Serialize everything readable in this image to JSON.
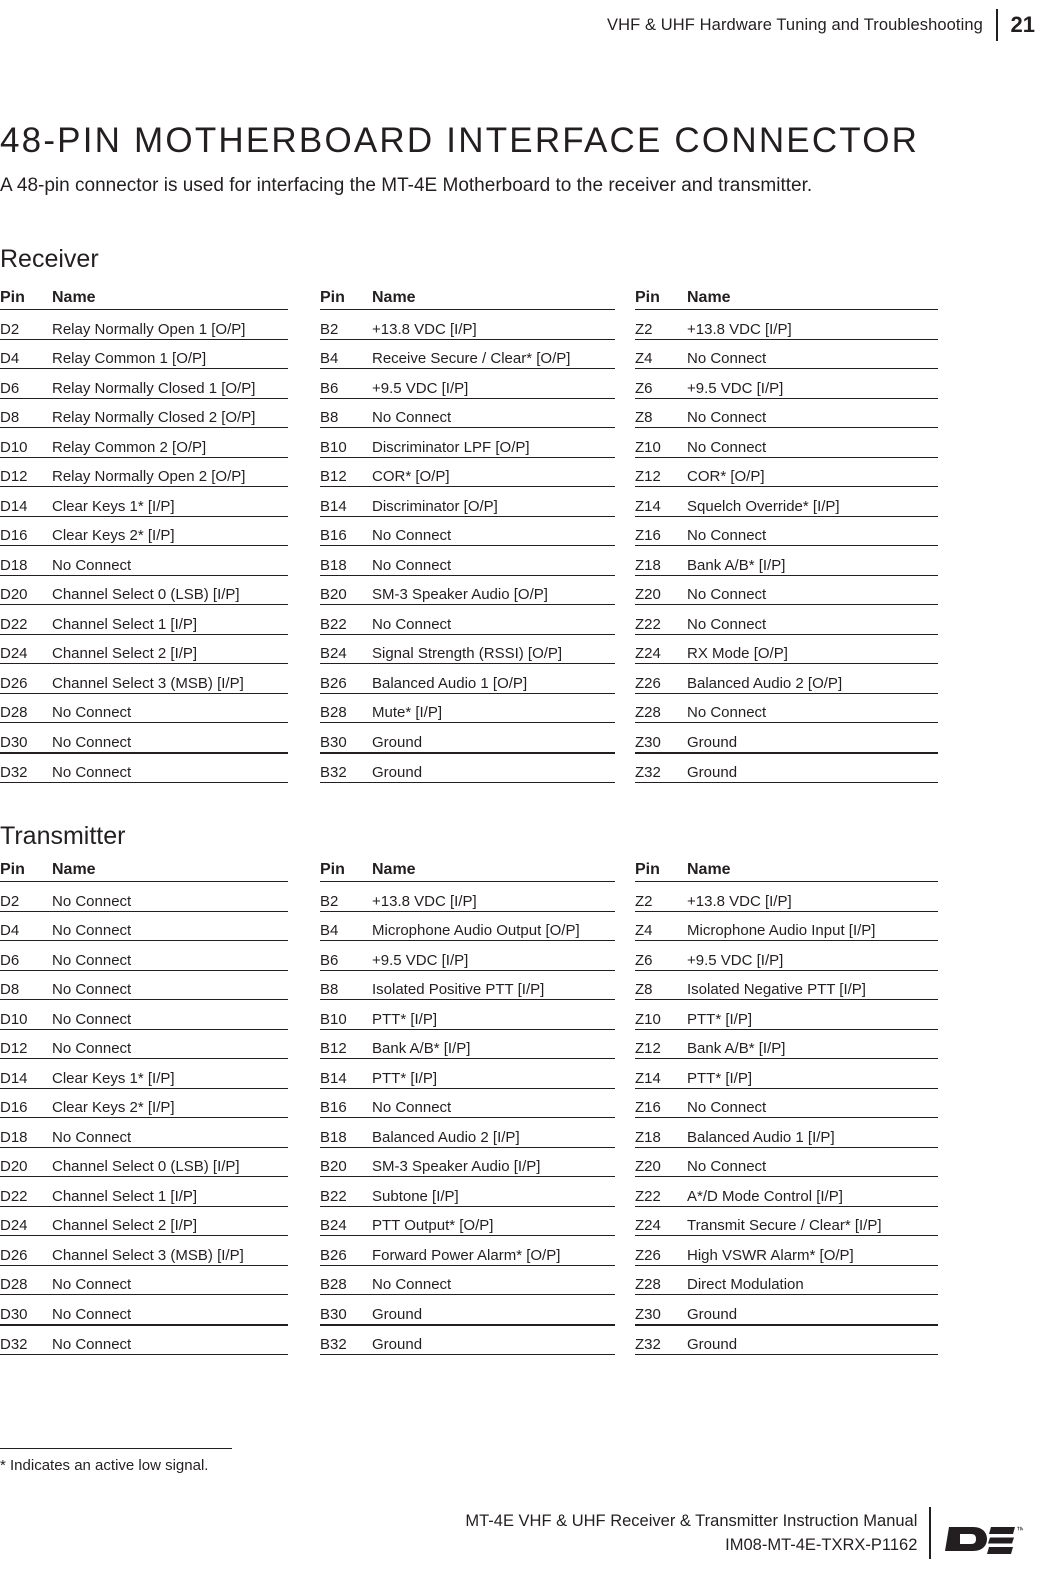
{
  "header": {
    "title": "VHF & UHF Hardware Tuning and Troubleshooting",
    "page_number": "21"
  },
  "title": "48-PIN MOTHERBOARD INTERFACE CONNECTOR",
  "intro": "A 48-pin connector is used for interfacing the MT-4E Motherboard to the receiver and transmitter.",
  "columns": {
    "pin": "Pin",
    "name": "Name"
  },
  "sections": [
    {
      "id": "receiver",
      "heading": "Receiver",
      "tables": [
        {
          "id": "receiver-d",
          "rows": [
            {
              "pin": "D2",
              "name": "Relay Normally Open 1 [O/P]"
            },
            {
              "pin": "D4",
              "name": "Relay Common 1 [O/P]"
            },
            {
              "pin": "D6",
              "name": "Relay Normally Closed 1 [O/P]"
            },
            {
              "pin": "D8",
              "name": "Relay Normally Closed 2 [O/P]"
            },
            {
              "pin": "D10",
              "name": "Relay Common 2 [O/P]"
            },
            {
              "pin": "D12",
              "name": "Relay Normally Open 2 [O/P]"
            },
            {
              "pin": "D14",
              "name": "Clear Keys 1* [I/P]"
            },
            {
              "pin": "D16",
              "name": "Clear Keys 2* [I/P]"
            },
            {
              "pin": "D18",
              "name": "No Connect"
            },
            {
              "pin": "D20",
              "name": "Channel Select 0 (LSB) [I/P]"
            },
            {
              "pin": "D22",
              "name": "Channel Select 1 [I/P]"
            },
            {
              "pin": "D24",
              "name": "Channel Select 2 [I/P]"
            },
            {
              "pin": "D26",
              "name": "Channel Select 3 (MSB) [I/P]"
            },
            {
              "pin": "D28",
              "name": "No Connect"
            },
            {
              "pin": "D30",
              "name": "No Connect"
            },
            {
              "pin": "D32",
              "name": "No Connect"
            }
          ]
        },
        {
          "id": "receiver-b",
          "rows": [
            {
              "pin": "B2",
              "name": "+13.8 VDC [I/P]"
            },
            {
              "pin": "B4",
              "name": "Receive Secure / Clear* [O/P]"
            },
            {
              "pin": "B6",
              "name": "+9.5 VDC [I/P]"
            },
            {
              "pin": "B8",
              "name": "No Connect"
            },
            {
              "pin": "B10",
              "name": "Discriminator LPF [O/P]"
            },
            {
              "pin": "B12",
              "name": "COR* [O/P]"
            },
            {
              "pin": "B14",
              "name": "Discriminator [O/P]"
            },
            {
              "pin": "B16",
              "name": "No Connect"
            },
            {
              "pin": "B18",
              "name": "No Connect"
            },
            {
              "pin": "B20",
              "name": "SM-3 Speaker Audio [O/P]"
            },
            {
              "pin": "B22",
              "name": "No Connect"
            },
            {
              "pin": "B24",
              "name": "Signal Strength (RSSI) [O/P]"
            },
            {
              "pin": "B26",
              "name": "Balanced Audio 1 [O/P]"
            },
            {
              "pin": "B28",
              "name": "Mute* [I/P]"
            },
            {
              "pin": "B30",
              "name": "Ground"
            },
            {
              "pin": "B32",
              "name": "Ground"
            }
          ]
        },
        {
          "id": "receiver-z",
          "rows": [
            {
              "pin": "Z2",
              "name": "+13.8 VDC [I/P]"
            },
            {
              "pin": "Z4",
              "name": "No Connect"
            },
            {
              "pin": "Z6",
              "name": "+9.5 VDC [I/P]"
            },
            {
              "pin": "Z8",
              "name": "No Connect"
            },
            {
              "pin": "Z10",
              "name": "No Connect"
            },
            {
              "pin": "Z12",
              "name": "COR* [O/P]"
            },
            {
              "pin": "Z14",
              "name": "Squelch Override* [I/P]"
            },
            {
              "pin": "Z16",
              "name": "No Connect"
            },
            {
              "pin": "Z18",
              "name": "Bank A/B* [I/P]"
            },
            {
              "pin": "Z20",
              "name": "No Connect"
            },
            {
              "pin": "Z22",
              "name": "No Connect"
            },
            {
              "pin": "Z24",
              "name": "RX Mode [O/P]"
            },
            {
              "pin": "Z26",
              "name": "Balanced Audio 2 [O/P]"
            },
            {
              "pin": "Z28",
              "name": "No Connect"
            },
            {
              "pin": "Z30",
              "name": "Ground"
            },
            {
              "pin": "Z32",
              "name": "Ground"
            }
          ]
        }
      ]
    },
    {
      "id": "transmitter",
      "heading": "Transmitter",
      "tables": [
        {
          "id": "transmitter-d",
          "rows": [
            {
              "pin": "D2",
              "name": "No Connect"
            },
            {
              "pin": "D4",
              "name": "No Connect"
            },
            {
              "pin": "D6",
              "name": "No Connect"
            },
            {
              "pin": "D8",
              "name": "No Connect"
            },
            {
              "pin": "D10",
              "name": "No Connect"
            },
            {
              "pin": "D12",
              "name": "No Connect"
            },
            {
              "pin": "D14",
              "name": "Clear Keys 1* [I/P]"
            },
            {
              "pin": "D16",
              "name": "Clear Keys 2* [I/P]"
            },
            {
              "pin": "D18",
              "name": "No Connect"
            },
            {
              "pin": "D20",
              "name": "Channel Select 0 (LSB) [I/P]"
            },
            {
              "pin": "D22",
              "name": "Channel Select 1 [I/P]"
            },
            {
              "pin": "D24",
              "name": "Channel Select 2 [I/P]"
            },
            {
              "pin": "D26",
              "name": "Channel Select 3 (MSB) [I/P]"
            },
            {
              "pin": "D28",
              "name": "No Connect"
            },
            {
              "pin": "D30",
              "name": "No Connect"
            },
            {
              "pin": "D32",
              "name": "No Connect"
            }
          ]
        },
        {
          "id": "transmitter-b",
          "rows": [
            {
              "pin": "B2",
              "name": "+13.8 VDC [I/P]"
            },
            {
              "pin": "B4",
              "name": "Microphone Audio Output [O/P]"
            },
            {
              "pin": "B6",
              "name": "+9.5 VDC [I/P]"
            },
            {
              "pin": "B8",
              "name": "Isolated Positive PTT [I/P]"
            },
            {
              "pin": "B10",
              "name": "PTT* [I/P]"
            },
            {
              "pin": "B12",
              "name": "Bank A/B* [I/P]"
            },
            {
              "pin": "B14",
              "name": "PTT* [I/P]"
            },
            {
              "pin": "B16",
              "name": "No Connect"
            },
            {
              "pin": "B18",
              "name": "Balanced Audio 2 [I/P]"
            },
            {
              "pin": "B20",
              "name": "SM-3 Speaker Audio [I/P]"
            },
            {
              "pin": "B22",
              "name": "Subtone [I/P]"
            },
            {
              "pin": "B24",
              "name": "PTT Output* [O/P]"
            },
            {
              "pin": "B26",
              "name": "Forward Power Alarm* [O/P]"
            },
            {
              "pin": "B28",
              "name": "No Connect"
            },
            {
              "pin": "B30",
              "name": "Ground"
            },
            {
              "pin": "B32",
              "name": "Ground"
            }
          ]
        },
        {
          "id": "transmitter-z",
          "rows": [
            {
              "pin": "Z2",
              "name": "+13.8 VDC [I/P]"
            },
            {
              "pin": "Z4",
              "name": "Microphone Audio Input [I/P]"
            },
            {
              "pin": "Z6",
              "name": "+9.5 VDC [I/P]"
            },
            {
              "pin": "Z8",
              "name": "Isolated Negative PTT [I/P]"
            },
            {
              "pin": "Z10",
              "name": "PTT* [I/P]"
            },
            {
              "pin": "Z12",
              "name": "Bank A/B* [I/P]"
            },
            {
              "pin": "Z14",
              "name": "PTT* [I/P]"
            },
            {
              "pin": "Z16",
              "name": "No Connect"
            },
            {
              "pin": "Z18",
              "name": "Balanced Audio 1 [I/P]"
            },
            {
              "pin": "Z20",
              "name": "No Connect"
            },
            {
              "pin": "Z22",
              "name": "A*/D Mode Control [I/P]"
            },
            {
              "pin": "Z24",
              "name": "Transmit Secure / Clear* [I/P]"
            },
            {
              "pin": "Z26",
              "name": "High VSWR Alarm* [O/P]"
            },
            {
              "pin": "Z28",
              "name": "Direct Modulation"
            },
            {
              "pin": "Z30",
              "name": "Ground"
            },
            {
              "pin": "Z32",
              "name": "Ground"
            }
          ]
        }
      ]
    }
  ],
  "footnote": "* Indicates an active low signal.",
  "footer": {
    "line1": "MT-4E VHF & UHF Receiver & Transmitter Instruction Manual",
    "line2": "IM08-MT-4E-TXRX-P1162",
    "logo_name": "DE",
    "trademark": "™"
  }
}
